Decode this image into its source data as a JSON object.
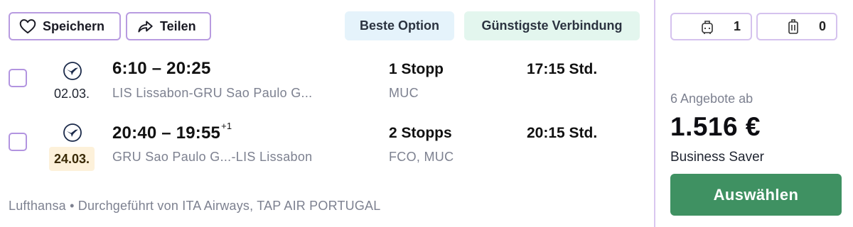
{
  "actions": {
    "save_label": "Speichern",
    "share_label": "Teilen"
  },
  "tags": {
    "best": "Beste Option",
    "cheapest": "Günstigste Verbindung"
  },
  "legs": [
    {
      "date": "02.03.",
      "departure": "6:10",
      "arrival": "20:25",
      "separator": " – ",
      "day_offset": "",
      "route": "LIS Lissabon-GRU Sao Paulo G...",
      "stops": "1 Stopp",
      "via": "MUC",
      "duration": "17:15 Std."
    },
    {
      "date": "24.03.",
      "departure": "20:40",
      "arrival": "19:55",
      "separator": " – ",
      "day_offset": "+1",
      "route": "GRU Sao Paulo G...-LIS Lissabon",
      "stops": "2 Stopps",
      "via": "FCO, MUC",
      "duration": "20:15 Std."
    }
  ],
  "carrier_line": "Lufthansa • Durchgeführt von ITA Airways, TAP AIR PORTUGAL",
  "baggage": {
    "cabin_count": "1",
    "checked_count": "0"
  },
  "offer": {
    "offers_label": "6 Angebote ab",
    "price": "1.516 €",
    "fare_name": "Business Saver",
    "select_label": "Auswählen"
  },
  "colors": {
    "accent_purple": "#b89be0",
    "select_green": "#3f9162",
    "best_tag_bg": "#e5f3fb",
    "cheap_tag_bg": "#e3f6ee",
    "date_highlight_bg": "#fdf1da"
  },
  "icons": {
    "save": "heart-icon",
    "share": "share-arrow-icon",
    "airline": "lufthansa-crane-icon",
    "cabin_bag": "cabin-bag-icon",
    "checked_bag": "checked-bag-icon"
  }
}
